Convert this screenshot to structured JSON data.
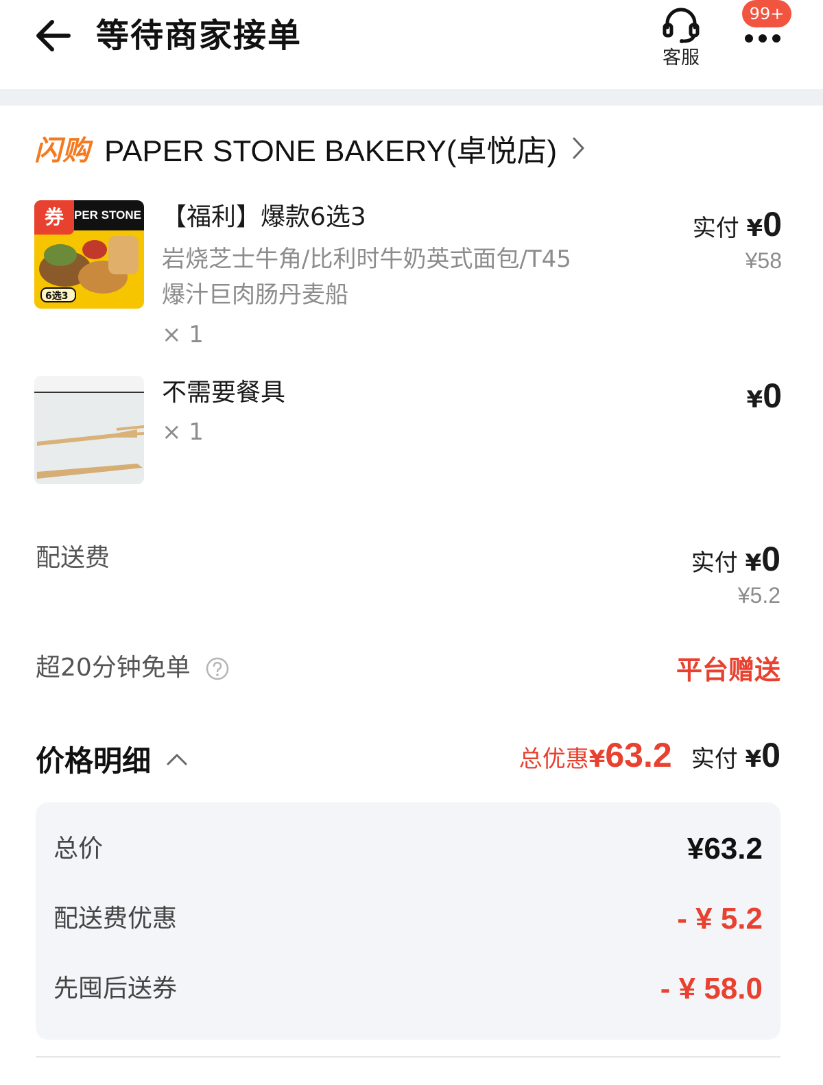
{
  "header": {
    "title": "等待商家接单",
    "customer_service_label": "客服",
    "notification_badge": "99+"
  },
  "store": {
    "logo_text": "闪购",
    "name": "PAPER STONE BAKERY(卓悦店)"
  },
  "items": [
    {
      "coupon_tag": "券",
      "image_brand": "PER STONE",
      "image_tag": "6选3",
      "title": "【福利】爆款6选3",
      "desc_line1": "岩烧芝士牛角/比利时牛奶英式面包/T45",
      "desc_line2": "爆汁巨肉肠丹麦船",
      "qty": "× 1",
      "pay_prefix": "实付",
      "yen": "¥",
      "pay_amount": "0",
      "original_price": "¥58"
    },
    {
      "title": "不需要餐具",
      "qty": "× 1",
      "yen": "¥",
      "pay_amount": "0"
    }
  ],
  "delivery_fee": {
    "label": "配送费",
    "pay_prefix": "实付",
    "yen": "¥",
    "pay_amount": "0",
    "original_price": "¥5.2"
  },
  "free_order": {
    "label": "超20分钟免单",
    "value": "平台赠送"
  },
  "price_detail": {
    "title": "价格明细",
    "total_discount_label": "总优惠",
    "total_discount_yen": "¥",
    "total_discount_amount": "63.2",
    "pay_prefix": "实付",
    "pay_yen": "¥",
    "pay_amount": "0",
    "rows": [
      {
        "label": "总价",
        "value": "¥63.2"
      },
      {
        "label": "配送费优惠",
        "value": "- ¥ 5.2"
      },
      {
        "label": "先囤后送券",
        "value": "- ¥ 58.0"
      }
    ]
  },
  "colors": {
    "accent_red": "#e8412f",
    "brand_orange": "#f57a1f",
    "badge_red": "#f2553f",
    "muted_gray": "#8c8c8c"
  }
}
